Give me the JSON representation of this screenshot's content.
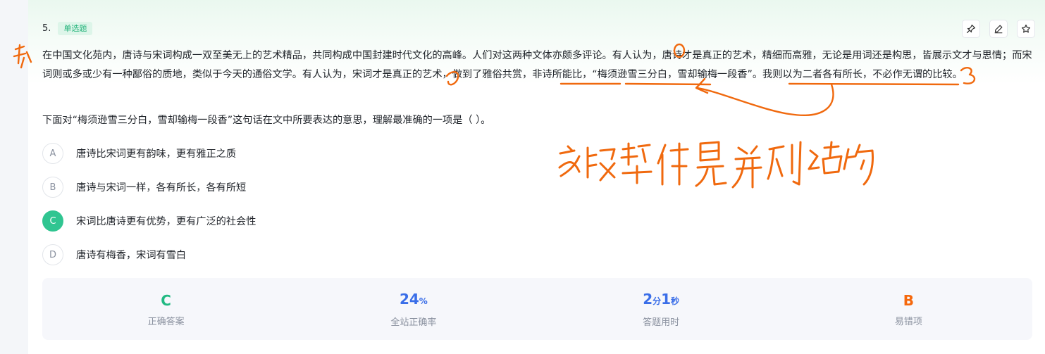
{
  "question": {
    "number": "5.",
    "type_tag": "单选题",
    "passage": "在中国文化苑内，唐诗与宋词构成一双至美无上的艺术精品，共同构成中国封建时代文化的高峰。人们对这两种文体亦颇多评论。有人认为，唐诗才是真正的艺术，精细而高雅，无论是用词还是构思，皆展示文才与思情；而宋词则或多或少有一种鄙俗的质地，类似于今天的通俗文学。有人认为，宋词才是真正的艺术，做到了雅俗共赏，非诗所能比，“梅须逊雪三分白，雪却输梅一段香”。我则以为二者各有所长，不必作无谓的比较。",
    "prompt": "下面对“梅须逊雪三分白，雪却输梅一段香”这句话在文中所要表达的意思，理解最准确的一项是（ ）。"
  },
  "toolbar": {
    "pin_icon": "pin-icon",
    "edit_icon": "edit-icon",
    "star_icon": "star-icon"
  },
  "options": [
    {
      "letter": "A",
      "text": "唐诗比宋词更有韵味，更有雅正之质",
      "selected": false
    },
    {
      "letter": "B",
      "text": "唐诗与宋词一样，各有所长，各有所短",
      "selected": false
    },
    {
      "letter": "C",
      "text": "宋词比唐诗更有优势，更有广泛的社会性",
      "selected": true
    },
    {
      "letter": "D",
      "text": "唐诗有梅香，宋词有雪白",
      "selected": false
    }
  ],
  "stats": {
    "correct_answer": {
      "value": "C",
      "label": "正确答案",
      "color": "#21b982"
    },
    "site_accuracy": {
      "value": "24",
      "unit": "%",
      "label": "全站正确率",
      "color": "#3a6ee8"
    },
    "time_used": {
      "min": "2",
      "min_unit": "分",
      "sec": "1",
      "sec_unit": "秒",
      "label": "答题用时",
      "color": "#3a6ee8"
    },
    "common_wrong": {
      "value": "B",
      "label": "易错项",
      "color": "#f5680c"
    }
  },
  "handwriting": {
    "margin_note": "并列",
    "main_note": "文段整体是并列结构",
    "color": "#f0690e"
  },
  "colors": {
    "accent_green": "#30c591",
    "annotation_orange": "#f0690e"
  }
}
